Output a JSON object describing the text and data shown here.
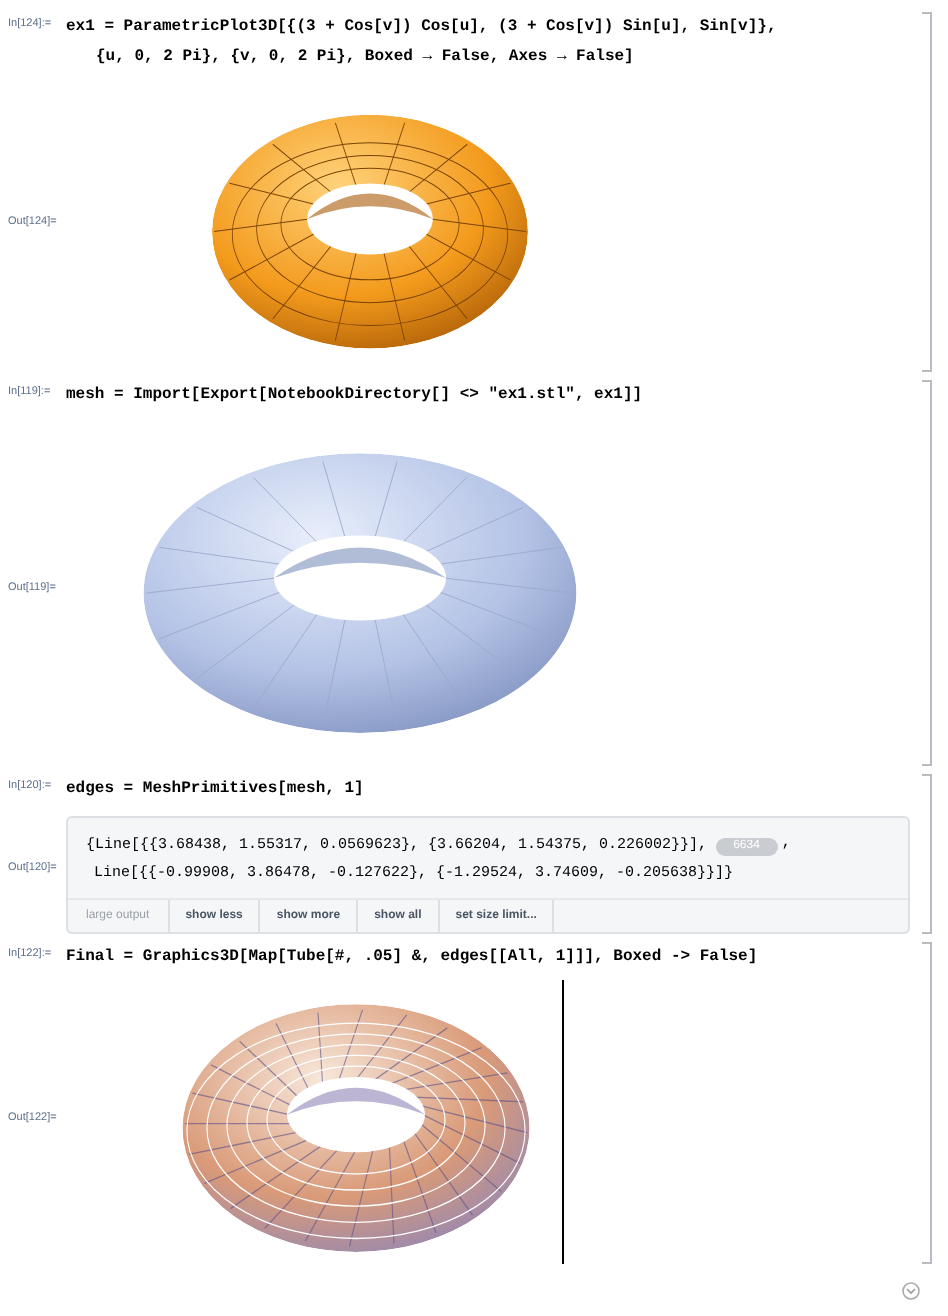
{
  "cells": [
    {
      "in_label": "In[124]:=",
      "code": [
        "ex1 = ParametricPlot3D[{(3 + Cos[v]) Cos[u], (3 + Cos[v]) Sin[u], Sin[v]},",
        "{u, 0, 2 Pi}, {v, 0, 2 Pi}, Boxed → False, Axes → False]"
      ],
      "out_label": "Out[124]=",
      "output": {
        "kind": "surface"
      }
    },
    {
      "in_label": "In[119]:=",
      "code": [
        "mesh = Import[Export[NotebookDirectory[] <> \"ex1.stl\", ex1]]"
      ],
      "out_label": "Out[119]=",
      "output": {
        "kind": "mesh"
      }
    },
    {
      "in_label": "In[120]:=",
      "code": [
        "edges = MeshPrimitives[mesh, 1]"
      ],
      "out_label": "Out[120]=",
      "output": {
        "kind": "large_output",
        "lines": [
          "{Line[{{3.68438, 1.55317, 0.0569623}, {3.66204, 1.54375, 0.226002}}],",
          "Line[{{-0.99908, 3.86478, -0.127622}, {-1.29524, 3.74609, -0.205638}}]}"
        ],
        "elided": "6634",
        "elided_suffix": ",",
        "label": "large output",
        "buttons": [
          "show less",
          "show more",
          "show all",
          "set size limit..."
        ]
      }
    },
    {
      "in_label": "In[122]:=",
      "code": [
        "Final = Graphics3D[Map[Tube[#, .05] &, edges[[All, 1]]], Boxed -> False]"
      ],
      "out_label": "Out[122]=",
      "output": {
        "kind": "tubes",
        "cursor": true
      }
    }
  ]
}
